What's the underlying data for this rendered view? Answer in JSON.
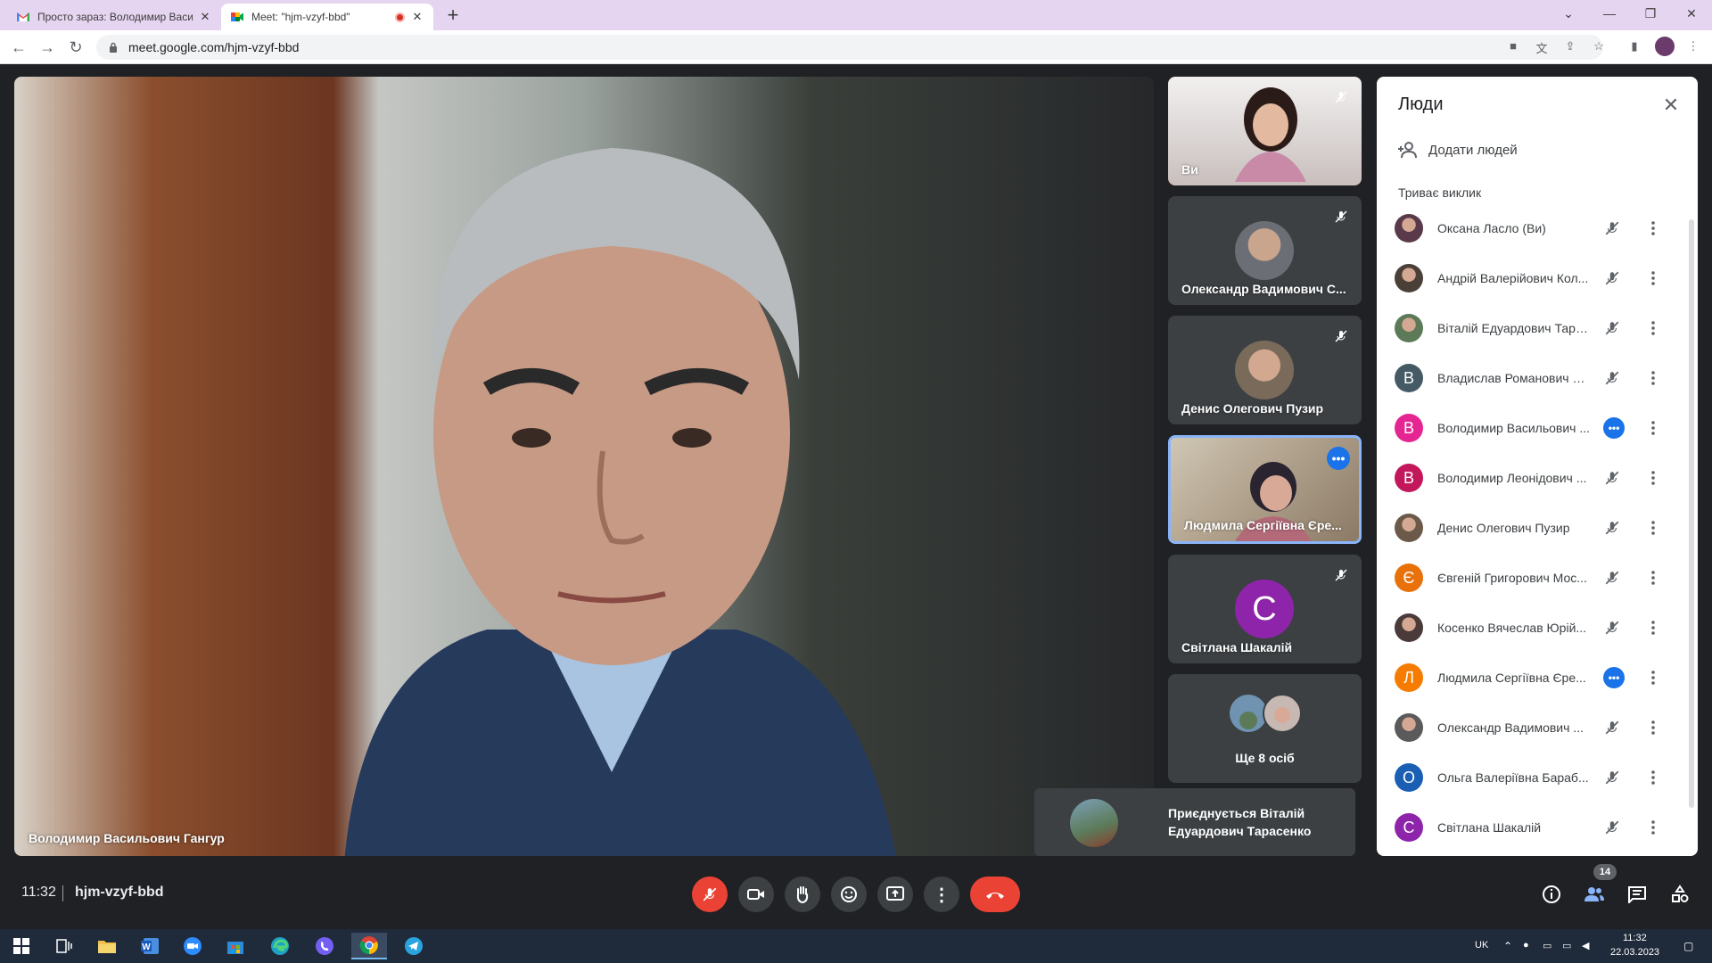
{
  "browser": {
    "tabs": [
      {
        "title": "Просто зараз: Володимир Васильович Гангур",
        "active": false
      },
      {
        "title": "Meet: \"hjm-vzyf-bbd\"",
        "active": true,
        "recording": true
      }
    ],
    "url": "meet.google.com/hjm-vzyf-bbd"
  },
  "meet": {
    "main_speaker": "Володимир Васильович Гангур",
    "tiles": [
      {
        "name": "Ви",
        "kind": "video",
        "muted": true
      },
      {
        "name": "Олександр Вадимович С...",
        "kind": "avatar",
        "muted": true
      },
      {
        "name": "Денис Олегович Пузир",
        "kind": "avatar",
        "muted": true
      },
      {
        "name": "Людмила Сергіївна Єре...",
        "kind": "video",
        "speaking": true
      },
      {
        "name": "Світлана Шакалій",
        "kind": "letter",
        "letter": "С",
        "muted": true
      }
    ],
    "more_tile": {
      "label": "Ще 8 осіб"
    },
    "toast": {
      "text": "Приєднується Віталій Едуардович Тарасенко"
    },
    "meeting_time": "11:32",
    "meeting_code": "hjm-vzyf-bbd",
    "participant_count": "14"
  },
  "people_panel": {
    "title": "Люди",
    "add_people": "Додати людей",
    "section": "Триває виклик",
    "participants": [
      {
        "name": "Оксана Ласло (Ви)",
        "avatar": "photo",
        "color": "#5a3a4a",
        "state": "muted"
      },
      {
        "name": "Андрій Валерійович Кол...",
        "avatar": "photo",
        "color": "#4a4038",
        "state": "muted"
      },
      {
        "name": "Віталій Едуардович Тара...",
        "avatar": "photo",
        "color": "#5c7a58",
        "state": "muted"
      },
      {
        "name": "Владислав Романович С...",
        "avatar": "letter",
        "letter": "В",
        "color": "#455a64",
        "state": "muted"
      },
      {
        "name": "Володимир Васильович ...",
        "avatar": "letter",
        "letter": "В",
        "color": "#e52592",
        "state": "speaking"
      },
      {
        "name": "Володимир Леонідович ...",
        "avatar": "letter",
        "letter": "В",
        "color": "#c2185b",
        "state": "muted"
      },
      {
        "name": "Денис Олегович Пузир",
        "avatar": "photo",
        "color": "#6b5a4a",
        "state": "muted"
      },
      {
        "name": "Євгеній Григорович Мос...",
        "avatar": "letter",
        "letter": "Є",
        "color": "#e8710a",
        "state": "muted"
      },
      {
        "name": "Косенко Вячеслав Юрій...",
        "avatar": "photo",
        "color": "#4a3a3a",
        "state": "muted"
      },
      {
        "name": "Людмила Сергіївна Єре...",
        "avatar": "letter",
        "letter": "Л",
        "color": "#f57c00",
        "state": "speaking"
      },
      {
        "name": "Олександр Вадимович ...",
        "avatar": "photo",
        "color": "#5a5a5a",
        "state": "muted"
      },
      {
        "name": "Ольга Валеріївна Бараб...",
        "avatar": "letter",
        "letter": "О",
        "color": "#1a5fb4",
        "state": "muted"
      },
      {
        "name": "Світлана Шакалій",
        "avatar": "letter",
        "letter": "С",
        "color": "#8e24aa",
        "state": "muted"
      }
    ]
  },
  "taskbar": {
    "lang": "UK",
    "time": "11:32",
    "date": "22.03.2023"
  }
}
